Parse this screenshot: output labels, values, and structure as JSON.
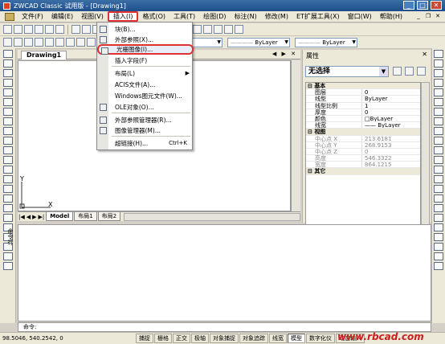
{
  "window": {
    "title": "ZWCAD Classic 试用版 - [Drawing1]"
  },
  "menubar": {
    "items": [
      "文件(F)",
      "编辑(E)",
      "视图(V)",
      "插入(I)",
      "格式(O)",
      "工具(T)",
      "绘图(D)",
      "标注(N)",
      "修改(M)",
      "ET扩展工具(X)",
      "窗口(W)",
      "帮助(H)"
    ],
    "active_index": 3
  },
  "toolbar2": {
    "layer_color": "ByLayer",
    "linetype": "ByLayer",
    "lineweight": "ByLayer"
  },
  "drawing": {
    "tab": "Drawing1",
    "tab_controls": "◀ ▶ ✕",
    "axis_x": "X",
    "axis_y": "Y"
  },
  "layout_tabs": {
    "nav": [
      "|◀",
      "◀",
      "▶",
      "▶|"
    ],
    "tabs": [
      "Model",
      "布局1",
      "布局2"
    ]
  },
  "insert_menu": {
    "items": [
      {
        "label": "块(B)...",
        "icon": "block-icon"
      },
      {
        "label": "外部参照(X)...",
        "icon": "xref-icon"
      },
      {
        "label": "光栅图像(I)...",
        "icon": "raster-image-icon",
        "highlighted": true
      },
      {
        "label": "插入字段(F)",
        "icon": ""
      },
      {
        "label": "布局(L)",
        "icon": "",
        "submenu": true
      },
      {
        "label": "ACIS文件(A)...",
        "icon": ""
      },
      {
        "label": "Windows图元文件(W)...",
        "icon": ""
      },
      {
        "label": "OLE对象(O)...",
        "icon": "ole-icon"
      },
      {
        "label": "外部参照管理器(R)...",
        "icon": "xref-manager-icon"
      },
      {
        "label": "图像管理器(M)...",
        "icon": "image-manager-icon"
      },
      {
        "label": "超链接(H)...",
        "icon": "",
        "shortcut": "Ctrl+K"
      }
    ]
  },
  "properties": {
    "title": "属性",
    "close": "✕",
    "selection": "无选择",
    "rows": [
      {
        "section": true,
        "label": "基本"
      },
      {
        "label": "图层",
        "value": "0"
      },
      {
        "label": "线型",
        "value": "ByLayer"
      },
      {
        "label": "线型比例",
        "value": "1"
      },
      {
        "label": "厚度",
        "value": "0"
      },
      {
        "label": "颜色",
        "value": "□ByLayer"
      },
      {
        "label": "线宽",
        "value": "—— ByLayer"
      },
      {
        "section": true,
        "label": "视图"
      },
      {
        "label": "中心点 X",
        "value": "213.6181",
        "disabled": true
      },
      {
        "label": "中心点 Y",
        "value": "268.9153",
        "disabled": true
      },
      {
        "label": "中心点 Z",
        "value": "0",
        "disabled": true
      },
      {
        "label": "高度",
        "value": "546.3322",
        "disabled": true
      },
      {
        "label": "宽度",
        "value": "864.1215",
        "disabled": true
      },
      {
        "section": true,
        "label": "其它"
      }
    ]
  },
  "command": {
    "side_label": "命令行",
    "prompt": "命令:"
  },
  "status": {
    "coords": "98.5046,  540.2542,  0",
    "buttons": [
      "捕捉",
      "栅格",
      "正交",
      "极轴",
      "对象捕捉",
      "对象追踪",
      "线宽",
      "模型",
      "数字化仪",
      "动态输入"
    ],
    "on": [
      "模型"
    ]
  },
  "watermark": "www.rbcad.com"
}
